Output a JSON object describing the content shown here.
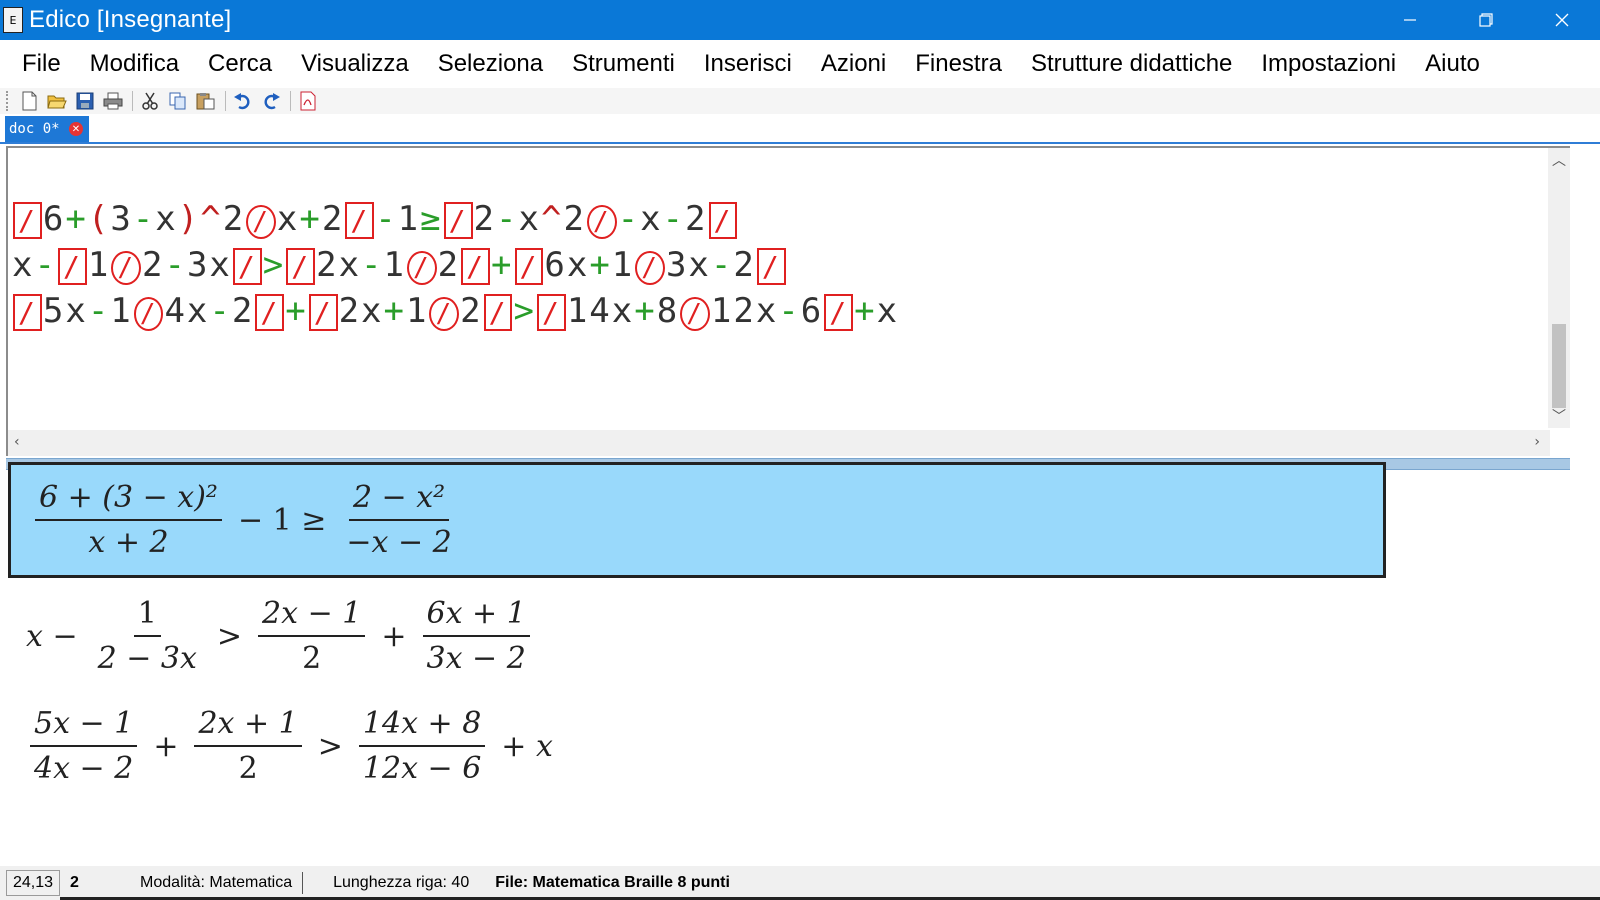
{
  "window": {
    "title": "Edico  [Insegnante]",
    "app_icon_glyph": "E"
  },
  "menu": {
    "items": [
      "File",
      "Modifica",
      "Cerca",
      "Visualizza",
      "Seleziona",
      "Strumenti",
      "Inserisci",
      "Azioni",
      "Finestra",
      "Strutture didattiche",
      "Impostazioni",
      "Aiuto"
    ]
  },
  "toolbar": {
    "icons": [
      "new-icon",
      "open-icon",
      "save-icon",
      "print-icon",
      "cut-icon",
      "copy-icon",
      "paste-icon",
      "undo-icon",
      "redo-icon",
      "pdf-icon"
    ]
  },
  "tabs": [
    {
      "label": "doc 0*"
    }
  ],
  "braille_editor": {
    "lines": [
      [
        [
          "sep",
          "/"
        ],
        [
          "k",
          "6"
        ],
        [
          "op",
          "+"
        ],
        [
          "sup",
          "("
        ],
        [
          "k",
          "3"
        ],
        [
          "op",
          "-"
        ],
        [
          "k",
          "x"
        ],
        [
          "sup",
          ")"
        ],
        [
          "sup",
          "^"
        ],
        [
          "k",
          "2"
        ],
        [
          "divd",
          "/"
        ],
        [
          "k",
          "x"
        ],
        [
          "op",
          "+"
        ],
        [
          "k",
          "2"
        ],
        [
          "sep",
          "/"
        ],
        [
          "op",
          "-"
        ],
        [
          "k",
          "1"
        ],
        [
          "op",
          "≥"
        ],
        [
          "sep",
          "/"
        ],
        [
          "k",
          "2"
        ],
        [
          "op",
          "-"
        ],
        [
          "k",
          "x"
        ],
        [
          "sup",
          "^"
        ],
        [
          "k",
          "2"
        ],
        [
          "divd",
          "/"
        ],
        [
          "op",
          "-"
        ],
        [
          "k",
          "x"
        ],
        [
          "op",
          "-"
        ],
        [
          "k",
          "2"
        ],
        [
          "sep",
          "/"
        ]
      ],
      [
        [
          "k",
          "x"
        ],
        [
          "op",
          "-"
        ],
        [
          "sep",
          "/"
        ],
        [
          "k",
          "1"
        ],
        [
          "divd",
          "/"
        ],
        [
          "k",
          "2"
        ],
        [
          "op",
          "-"
        ],
        [
          "k",
          "3x"
        ],
        [
          "sep",
          "/"
        ],
        [
          "op",
          ">"
        ],
        [
          "sep",
          "/"
        ],
        [
          "k",
          "2x"
        ],
        [
          "op",
          "-"
        ],
        [
          "k",
          "1"
        ],
        [
          "divd",
          "/"
        ],
        [
          "k",
          "2"
        ],
        [
          "sep",
          "/"
        ],
        [
          "op",
          "+"
        ],
        [
          "sep",
          "/"
        ],
        [
          "k",
          "6x"
        ],
        [
          "op",
          "+"
        ],
        [
          "k",
          "1"
        ],
        [
          "divd",
          "/"
        ],
        [
          "k",
          "3x"
        ],
        [
          "op",
          "-"
        ],
        [
          "k",
          "2"
        ],
        [
          "sep",
          "/"
        ]
      ],
      [
        [
          "sep",
          "/"
        ],
        [
          "k",
          "5x"
        ],
        [
          "op",
          "-"
        ],
        [
          "k",
          "1"
        ],
        [
          "divd",
          "/"
        ],
        [
          "k",
          "4x"
        ],
        [
          "op",
          "-"
        ],
        [
          "k",
          "2"
        ],
        [
          "sep",
          "/"
        ],
        [
          "op",
          "+"
        ],
        [
          "sep",
          "/"
        ],
        [
          "k",
          "2x"
        ],
        [
          "op",
          "+"
        ],
        [
          "k",
          "1"
        ],
        [
          "divd",
          "/"
        ],
        [
          "k",
          "2"
        ],
        [
          "sep",
          "/"
        ],
        [
          "op",
          ">"
        ],
        [
          "sep",
          "/"
        ],
        [
          "k",
          "14x"
        ],
        [
          "op",
          "+"
        ],
        [
          "k",
          "8"
        ],
        [
          "divd",
          "/"
        ],
        [
          "k",
          "12x"
        ],
        [
          "op",
          "-"
        ],
        [
          "k",
          "6"
        ],
        [
          "sep",
          "/"
        ],
        [
          "op",
          "+"
        ],
        [
          "k",
          "x"
        ]
      ]
    ]
  },
  "math": {
    "row1": {
      "frac1_num": "6 + (3 − x)²",
      "frac1_den": "x + 2",
      "middle": "− 1 ≥",
      "frac2_num": "2 − x²",
      "frac2_den": "−x − 2"
    },
    "row2": {
      "lead": "x −",
      "frac1_num": "1",
      "frac1_den": "2 − 3x",
      "rel": ">",
      "frac2_num": "2x − 1",
      "frac2_den": "2",
      "plus": "+",
      "frac3_num": "6x + 1",
      "frac3_den": "3x − 2"
    },
    "row3": {
      "frac1_num": "5x − 1",
      "frac1_den": "4x − 2",
      "plus": "+",
      "frac2_num": "2x + 1",
      "frac2_den": "2",
      "rel": ">",
      "frac3_num": "14x + 8",
      "frac3_den": "12x − 6",
      "tail": "+ x"
    }
  },
  "statusbar": {
    "position": "24,13",
    "page": "2",
    "mode": "Modalità: Matematica",
    "line_length": "Lunghezza riga: 40",
    "file": "File: Matematica  Braille 8 punti"
  },
  "colors": {
    "titlebar": "#0a78d7",
    "selected_row": "#99d9fb",
    "braille_separator": "#e02020",
    "braille_operator": "#2a9d2a"
  }
}
